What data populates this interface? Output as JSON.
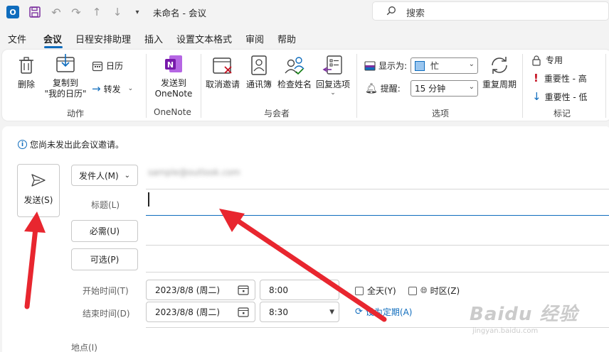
{
  "titlebar": {
    "app_icon_letter": "O",
    "window_title": "未命名 - 会议",
    "search_placeholder": "搜索"
  },
  "tabs": [
    {
      "label": "文件",
      "active": false
    },
    {
      "label": "会议",
      "active": true
    },
    {
      "label": "日程安排助理",
      "active": false
    },
    {
      "label": "插入",
      "active": false
    },
    {
      "label": "设置文本格式",
      "active": false
    },
    {
      "label": "审阅",
      "active": false
    },
    {
      "label": "帮助",
      "active": false
    }
  ],
  "ribbon": {
    "actions": {
      "delete": "删除",
      "copy_to_line1": "复制到",
      "copy_to_line2": "\"我的日历\"",
      "calendar": "日历",
      "forward": "转发",
      "group_label": "动作"
    },
    "onenote": {
      "send_line1": "发送到",
      "send_line2": "OneNote",
      "group_label": "OneNote"
    },
    "attendees": {
      "cancel_invite": "取消邀请",
      "address_book": "通讯簿",
      "check_names": "检查姓名",
      "response_options": "回复选项",
      "group_label": "与会者"
    },
    "options": {
      "show_as_label": "显示为:",
      "show_as_value": "忙",
      "reminder_label": "提醒:",
      "reminder_value": "15 分钟",
      "recurrence": "重复周期",
      "group_label": "选项"
    },
    "tags": {
      "private": "专用",
      "high_importance": "重要性 - 高",
      "low_importance": "重要性 - 低",
      "group_label": "标记"
    }
  },
  "compose": {
    "info_message": "您尚未发出此会议邀请。",
    "send_label": "发送(S)",
    "from_label": "发件人(M)",
    "from_value": "sample@outlook.com",
    "subject_label": "标题(L)",
    "subject_value": "",
    "required_label": "必需(U)",
    "optional_label": "可选(P)",
    "start_label": "开始时间(T)",
    "start_date": "2023/8/8 (周二)",
    "start_time": "8:00",
    "all_day_label": "全天(Y)",
    "timezone_label": "时区(Z)",
    "end_label": "结束时间(D)",
    "end_date": "2023/8/8 (周二)",
    "end_time": "8:30",
    "recurrence_link": "设为定期(A)",
    "location_label": "地点(I)"
  },
  "watermark": {
    "brand": "Baidu 经验",
    "url": "jingyan.baidu.com"
  },
  "colors": {
    "accent": "#0f6cbd",
    "arrow": "#e8262f",
    "importance_high": "#c50f1f"
  }
}
